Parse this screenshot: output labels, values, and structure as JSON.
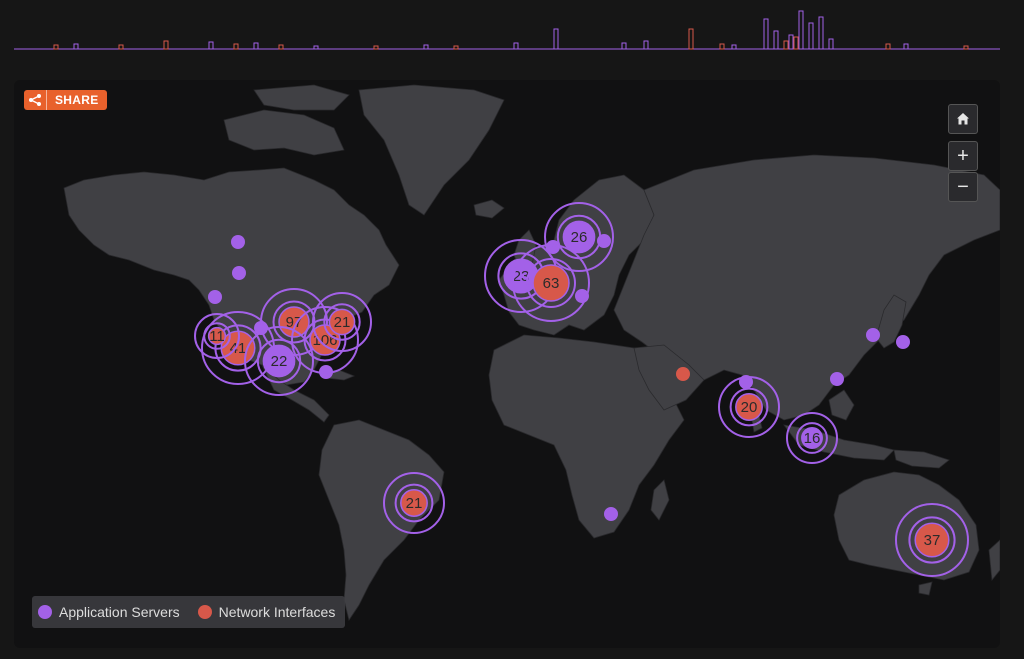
{
  "share": {
    "label": "SHARE",
    "icon": "share-icon"
  },
  "controls": {
    "home_icon": "home-icon",
    "zoom_in": "+",
    "zoom_out": "−"
  },
  "legend": {
    "items": [
      {
        "label": "Application Servers",
        "color": "#a361e8"
      },
      {
        "label": "Network Interfaces",
        "color": "#d7584a"
      }
    ]
  },
  "colors": {
    "application": "#a361e8",
    "network": "#d7584a",
    "accent": "#e8612c",
    "land": "#404044",
    "background": "#161616"
  },
  "clusters": [
    {
      "label": "97",
      "type": "network"
    },
    {
      "label": "106",
      "type": "network"
    },
    {
      "label": "21",
      "type": "network"
    },
    {
      "label": "41",
      "type": "network"
    },
    {
      "label": "11",
      "type": "network"
    },
    {
      "label": "22",
      "type": "application"
    },
    {
      "label": "23",
      "type": "application"
    },
    {
      "label": "63",
      "type": "network"
    },
    {
      "label": "26",
      "type": "application"
    },
    {
      "label": "20",
      "type": "network"
    },
    {
      "label": "16",
      "type": "application"
    },
    {
      "label": "21",
      "type": "network"
    },
    {
      "label": "37",
      "type": "network"
    }
  ]
}
